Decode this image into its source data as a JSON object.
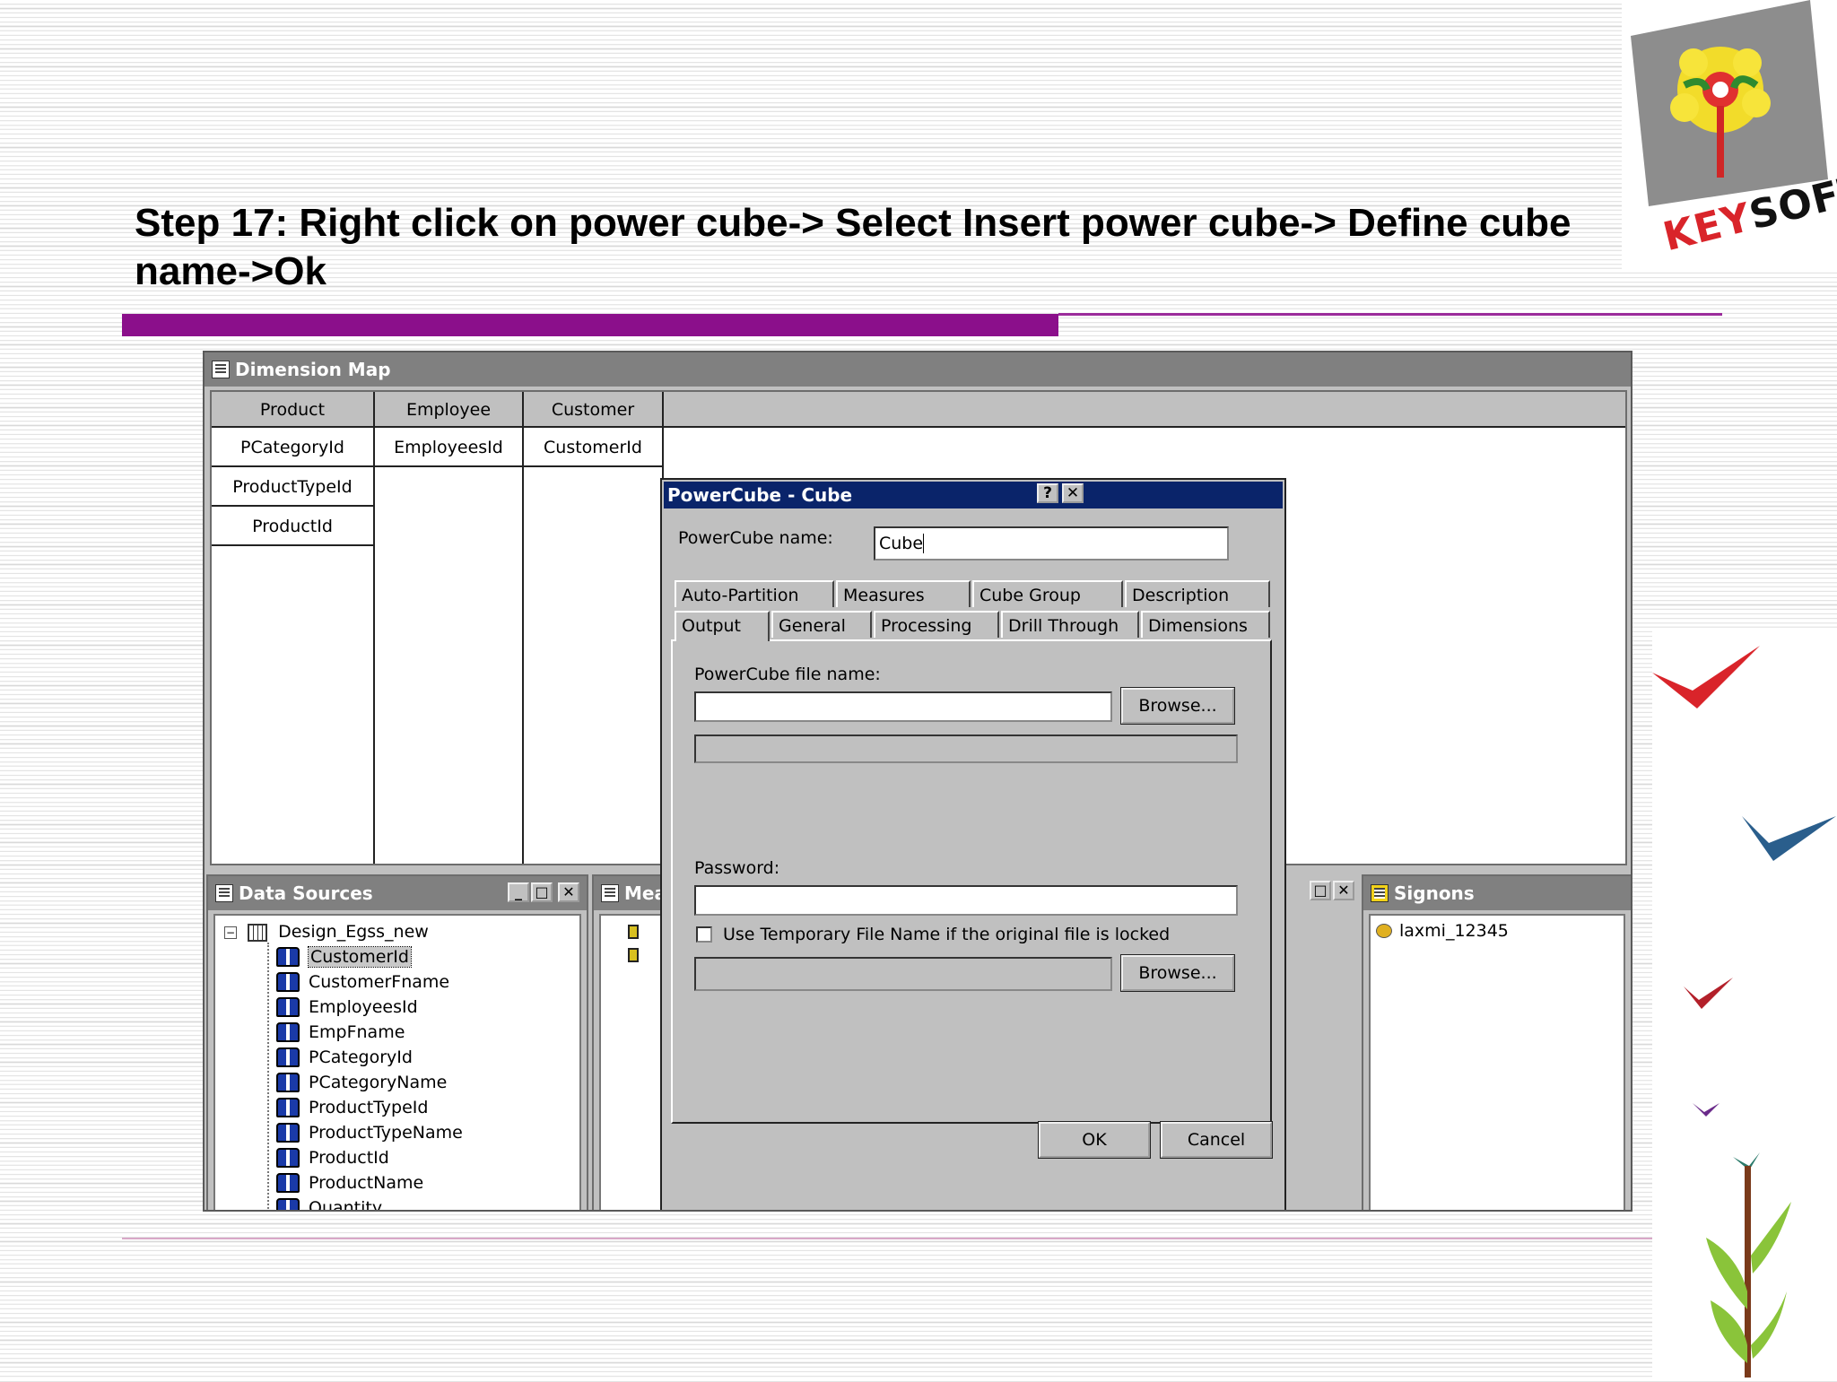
{
  "slide": {
    "title": "Step 17: Right click on power cube-> Select Insert power cube-> Define cube name->Ok",
    "logo_text_a": "KEY",
    "logo_text_b": "SOFT"
  },
  "dimension_map": {
    "title": "Dimension Map",
    "columns": [
      {
        "header": "Product",
        "cells": [
          "PCategoryId",
          "ProductTypeId",
          "ProductId"
        ]
      },
      {
        "header": "Employee",
        "cells": [
          "EmployeesId"
        ]
      },
      {
        "header": "Customer",
        "cells": [
          "CustomerId"
        ]
      }
    ]
  },
  "data_sources": {
    "title": "Data Sources",
    "root": "Design_Egss_new",
    "items": [
      "CustomerId",
      "CustomerFname",
      "EmployeesId",
      "EmpFname",
      "PCategoryId",
      "PCategoryName",
      "ProductTypeId",
      "ProductTypeName",
      "ProductId",
      "ProductName",
      "Quantity"
    ],
    "selected_item": "CustomerId"
  },
  "measures_pane": {
    "title": "Mea"
  },
  "signons": {
    "title": "Signons",
    "items": [
      "laxmi_12345"
    ]
  },
  "dialog": {
    "title": "PowerCube - Cube",
    "help_button": "?",
    "close_button": "✕",
    "name_label": "PowerCube name:",
    "name_value": "Cube",
    "tabs_row1": [
      "Auto-Partition",
      "Measures",
      "Cube Group",
      "Description"
    ],
    "tabs_row2": [
      "Output",
      "General",
      "Processing",
      "Drill Through",
      "Dimensions"
    ],
    "active_tab": "Output",
    "file_name_label": "PowerCube file name:",
    "file_name_value": "",
    "browse_label": "Browse...",
    "password_label": "Password:",
    "temp_file_label": "Use Temporary File Name if the original file is locked",
    "temp_file_checked": false,
    "browse2_label": "Browse...",
    "ok_label": "OK",
    "cancel_label": "Cancel"
  }
}
